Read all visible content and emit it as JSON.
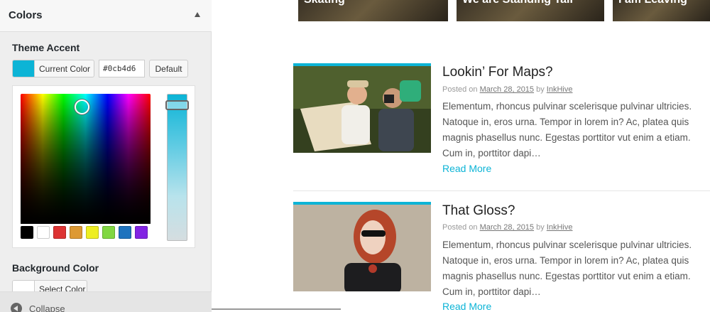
{
  "sidebar": {
    "section_title": "Colors",
    "theme_accent": {
      "title": "Theme Accent",
      "current_color_label": "Current Color",
      "hex_value": "#0cb4d6",
      "default_label": "Default",
      "swatch_color": "#0cb4d6",
      "palette": [
        "#000000",
        "#ffffff",
        "#dd3333",
        "#dd9933",
        "#eeee22",
        "#81d742",
        "#1e73be",
        "#8224e3"
      ]
    },
    "background_color": {
      "title": "Background Color",
      "select_label": "Select Color"
    },
    "collapse_label": "Collapse"
  },
  "preview": {
    "top_thumbs": [
      "Skating",
      "We are Standing Tall",
      "I am Leaving"
    ],
    "posts": [
      {
        "title": "Lookin’ For Maps?",
        "posted_on": "Posted on",
        "date": "March 28, 2015",
        "by": "by",
        "author": "InkHive",
        "excerpt": "Elementum, rhoncus pulvinar scelerisque pulvinar ultricies. Natoque in, eros urna. Tempor in lorem in? Ac, platea quis magnis phasellus nunc. Egestas porttitor vut enim a etiam. Cum in, porttitor dapi…",
        "read_more": "Read More"
      },
      {
        "title": "That Gloss?",
        "posted_on": "Posted on",
        "date": "March 28, 2015",
        "by": "by",
        "author": "InkHive",
        "excerpt": "Elementum, rhoncus pulvinar scelerisque pulvinar ultricies. Natoque in, eros urna. Tempor in lorem in? Ac, platea quis magnis phasellus nunc. Egestas porttitor vut enim a etiam. Cum in, porttitor dapi…",
        "read_more": "Read More"
      }
    ]
  },
  "colors": {
    "accent": "#0cb4d6"
  }
}
